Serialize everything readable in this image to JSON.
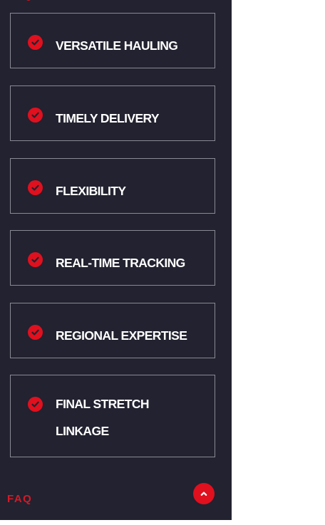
{
  "colors": {
    "panel_background": "#222230",
    "card_border": "#8a8a96",
    "accent_red": "#e0101e",
    "text_white": "#ffffff",
    "page_background": "#ffffff"
  },
  "features": [
    {
      "icon": "check-circle-icon",
      "label": "VERSATILE HAULING"
    },
    {
      "icon": "check-circle-icon",
      "label": "TIMELY DELIVERY"
    },
    {
      "icon": "check-circle-icon",
      "label": "FLEXIBILITY"
    },
    {
      "icon": "check-circle-icon",
      "label": "REAL-TIME TRACKING"
    },
    {
      "icon": "check-circle-icon",
      "label": "REGIONAL EXPERTISE"
    },
    {
      "icon": "check-circle-icon",
      "label": "FINAL STRETCH LINKAGE"
    }
  ],
  "footer": {
    "faq_label": "FAQ",
    "back_to_top_icon": "chevron-up-icon"
  }
}
